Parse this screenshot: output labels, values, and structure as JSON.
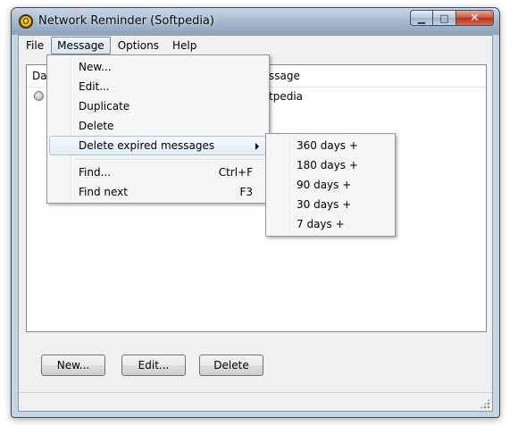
{
  "window": {
    "title": "Network Reminder (Softpedia)",
    "minimize_glyph": "▁",
    "maximize_glyph": "□",
    "close_glyph": "✕"
  },
  "menubar": {
    "items": [
      {
        "label": "File"
      },
      {
        "label": "Message",
        "active": true
      },
      {
        "label": "Options"
      },
      {
        "label": "Help"
      }
    ]
  },
  "list": {
    "columns": [
      "Dat",
      "ssage"
    ],
    "rows": [
      {
        "status_icon": "circle-icon",
        "message": "tpedia"
      }
    ]
  },
  "message_menu": {
    "new": "New...",
    "edit": "Edit...",
    "duplicate": "Duplicate",
    "delete": "Delete",
    "delete_expired": "Delete expired messages",
    "find": "Find...",
    "find_shortcut": "Ctrl+F",
    "find_next": "Find next",
    "find_next_shortcut": "F3"
  },
  "expired_submenu": {
    "items": [
      "360 days +",
      "180 days +",
      "90 days +",
      "30 days +",
      "7 days +"
    ]
  },
  "buttons": {
    "new": "New...",
    "edit": "Edit...",
    "delete": "Delete"
  },
  "colors": {
    "menu_highlight_border": "#a8c4e3",
    "frame": "#9fb3c9",
    "close_button": "#c8412a"
  }
}
